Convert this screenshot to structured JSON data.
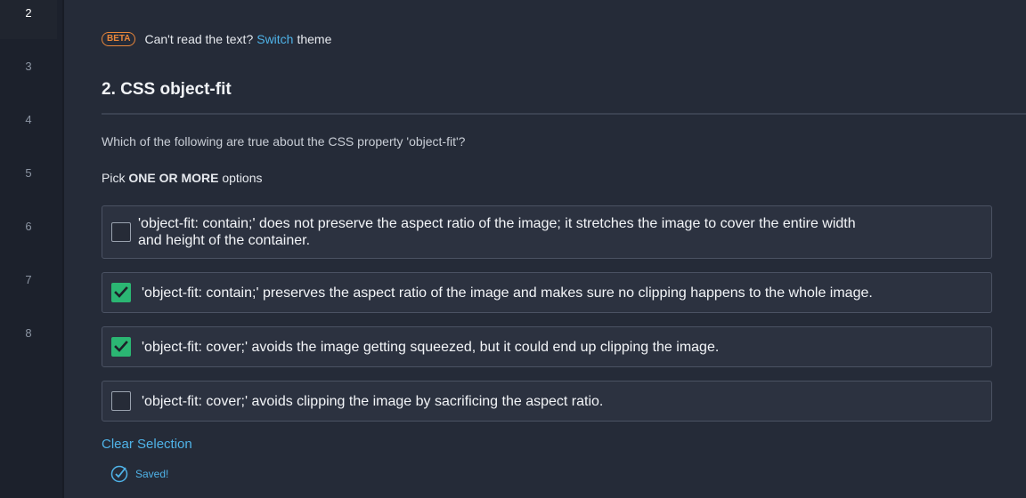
{
  "sidebar": {
    "questions": [
      "2",
      "3",
      "4",
      "5",
      "6",
      "7",
      "8"
    ],
    "current": "2"
  },
  "banner": {
    "badge": "BETA",
    "text_before": "Can't read the text?",
    "link": "Switch",
    "text_after": "theme"
  },
  "question": {
    "title": "2. CSS object-fit",
    "prompt": "Which of the following are true about the CSS property 'object-fit'?",
    "pick_prefix": "Pick",
    "pick_emphasis": "ONE OR MORE",
    "pick_suffix": "options"
  },
  "options": [
    {
      "line1": "'object-fit: contain;' does not preserve the aspect ratio of the image; it stretches the image to cover the entire width",
      "line2": "and height of the container.",
      "checked": false
    },
    {
      "line1": "'object-fit: contain;' preserves the aspect ratio of the image and makes sure no clipping happens to the whole image.",
      "checked": true
    },
    {
      "line1": "'object-fit: cover;' avoids the image getting squeezed, but it could end up clipping the image.",
      "checked": true
    },
    {
      "line1": "'object-fit: cover;' avoids clipping the image by sacrificing the aspect ratio.",
      "checked": false
    }
  ],
  "footer": {
    "clear_label": "Clear Selection",
    "saved_label": "Saved!"
  },
  "colors": {
    "accent": "#4fb3e8",
    "checked": "#2bb673",
    "beta": "#e8863a"
  }
}
